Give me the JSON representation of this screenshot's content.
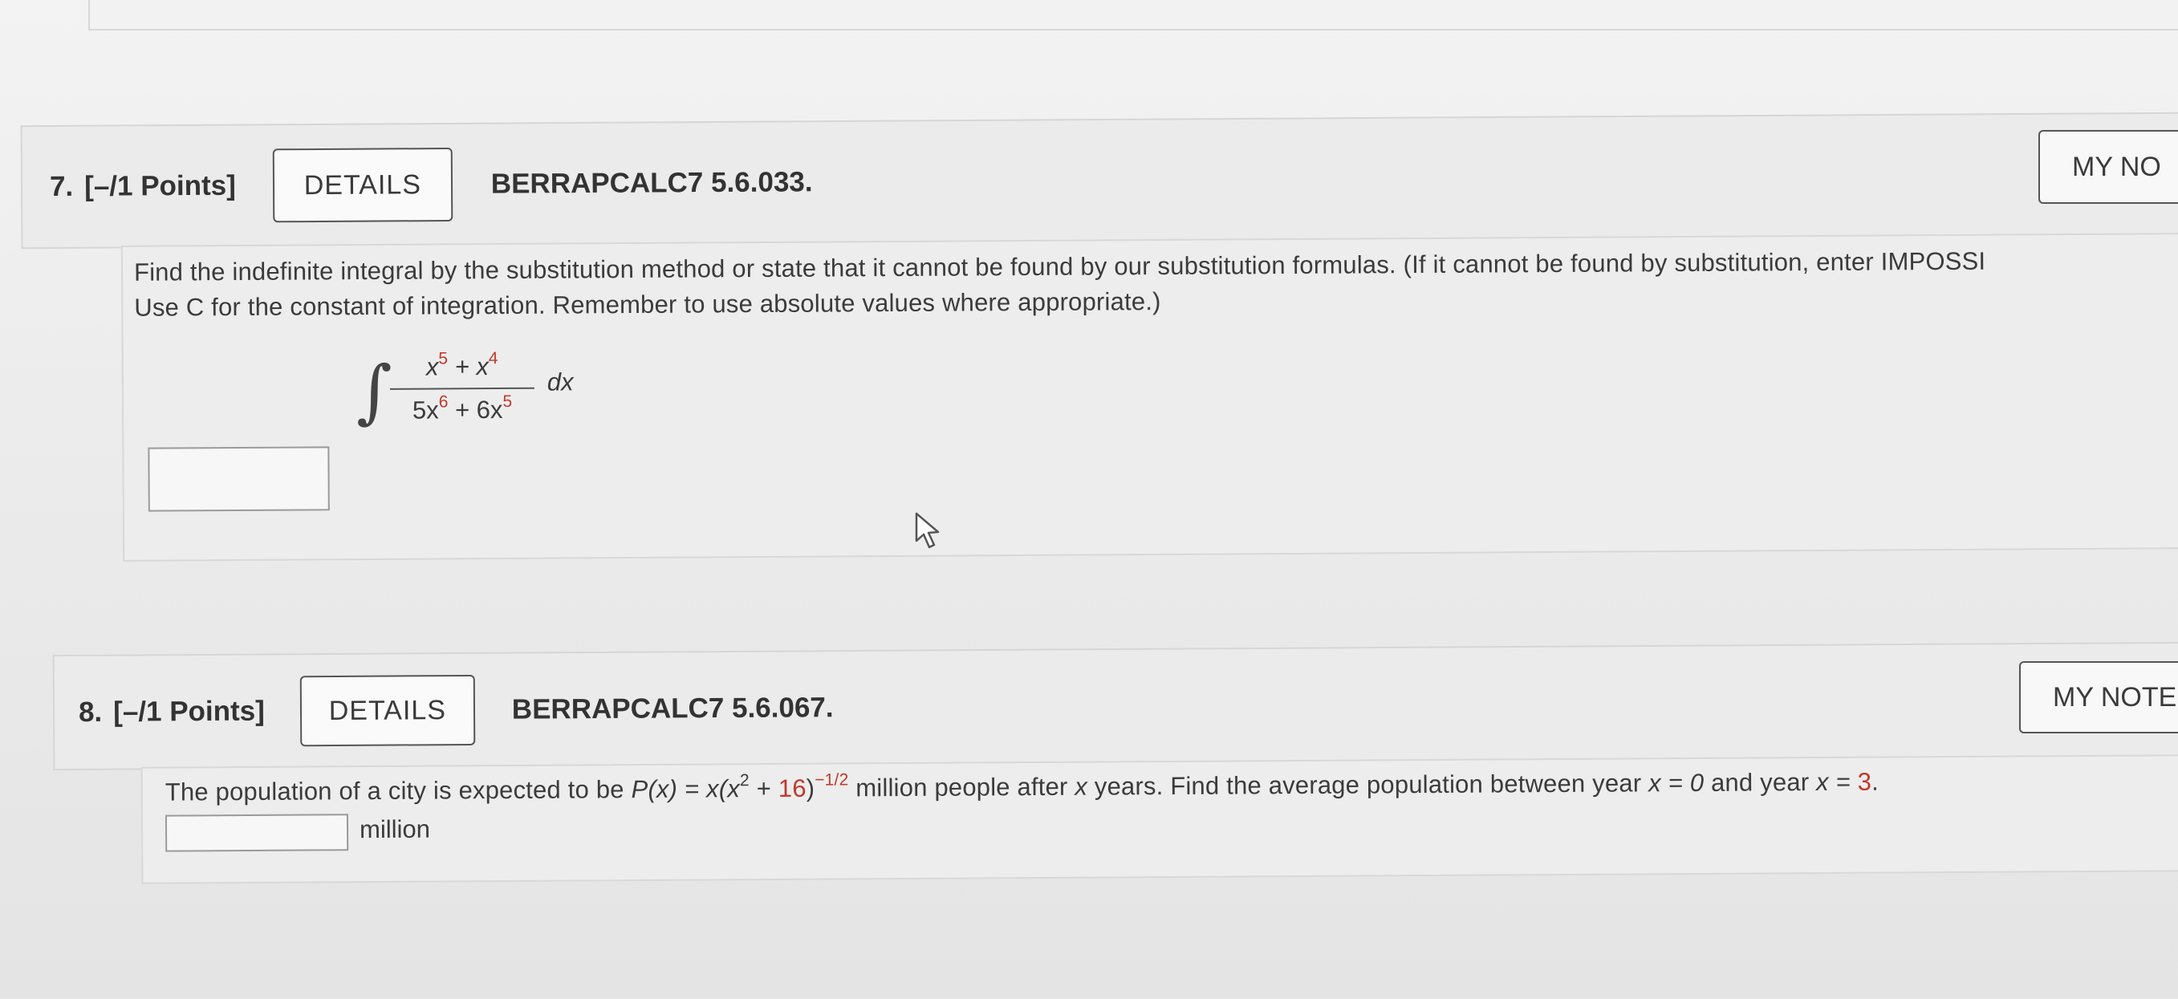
{
  "q7": {
    "number": "7.",
    "points": "[–/1 Points]",
    "details_label": "DETAILS",
    "code": "BERRAPCALC7 5.6.033.",
    "notes_label": "MY NO",
    "instructions_line1": "Find the indefinite integral by the substitution method or state that it cannot be found by our substitution formulas. (If it cannot be found by substitution, enter IMPOSSI",
    "instructions_line2": "Use C for the constant of integration. Remember to use absolute values where appropriate.)",
    "integral": {
      "symbol": "∫",
      "numerator_x": "x",
      "numerator_exp1": "5",
      "numerator_plus": " + x",
      "numerator_exp2": "4",
      "denominator_a": "5x",
      "denominator_exp1": "6",
      "denominator_b": " + 6x",
      "denominator_exp2": "5",
      "differential": "dx"
    },
    "answer_value": ""
  },
  "q8": {
    "number": "8.",
    "points": "[–/1 Points]",
    "details_label": "DETAILS",
    "code": "BERRAPCALC7 5.6.067.",
    "notes_label": "MY NOTE",
    "text_pre": "The population of a city is expected to be ",
    "func": "P(x) = x(x",
    "exp_a": "2",
    "mid": " + ",
    "constant": "16",
    "close": ")",
    "exp_b": "−1/2",
    "text_post": " million people after ",
    "var": "x",
    "text_post2": " years. Find the average population between year ",
    "x0": "x = 0",
    "and_year": " and year ",
    "x1_lhs": "x = ",
    "x1_val": "3",
    "period": ".",
    "answer_value": "",
    "unit_label": "million"
  },
  "colors": {
    "accent_red": "#c0392b"
  },
  "icons": {
    "cursor": "arrow-cursor-icon"
  }
}
